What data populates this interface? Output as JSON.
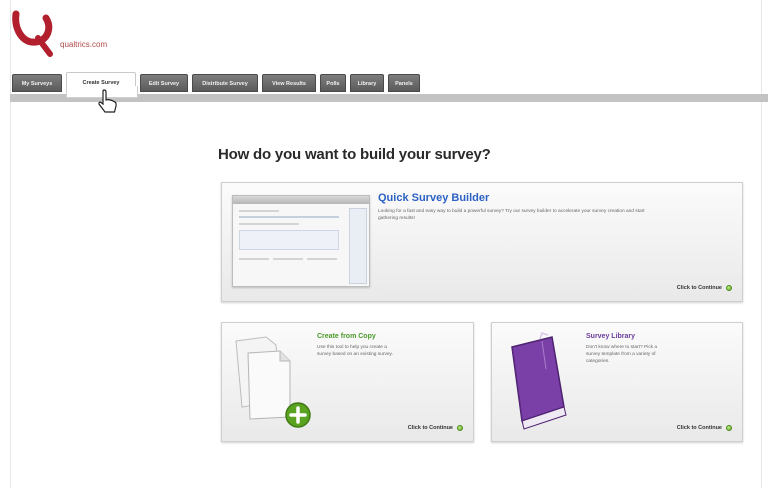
{
  "app": {
    "logo_text": "qualtrics.com"
  },
  "tabs": [
    {
      "label": "My Surveys",
      "active": false
    },
    {
      "label": "Create Survey",
      "active": true
    },
    {
      "label": "Edit Survey",
      "active": false
    },
    {
      "label": "Distribute Survey",
      "active": false
    },
    {
      "label": "View Results",
      "active": false
    },
    {
      "label": "Polls",
      "active": false
    },
    {
      "label": "Library",
      "active": false
    },
    {
      "label": "Panels",
      "active": false
    }
  ],
  "main": {
    "heading": "How do you want to build your survey?",
    "cards": {
      "quick_builder": {
        "title": "Quick Survey Builder",
        "description": "Looking for a fast and easy way to build a powerful survey? Try our survey builder to accelerate your survey creation and start gathering results!",
        "continue_label": "Click to Continue"
      },
      "create_from_copy": {
        "title": "Create from Copy",
        "description": "Use this tool to help you create a survey based on an existing survey.",
        "continue_label": "Click to Continue"
      },
      "survey_library": {
        "title": "Survey Library",
        "description": "Don't know where to start? Pick a survey template from a variety of categories.",
        "continue_label": "Click to Continue"
      }
    }
  },
  "colors": {
    "quick_title": "#2c62c4",
    "copy_title": "#4a9a2a",
    "library_title": "#6a3c9a",
    "logo_red": "#b21f2d",
    "tab_gray": "#666666"
  },
  "icons": {
    "logo": "qualtrics-q-logo",
    "cursor": "hand-pointer-icon",
    "copy": "documents-plus-icon",
    "library": "purple-book-icon",
    "go": "green-arrow-circle-icon"
  }
}
